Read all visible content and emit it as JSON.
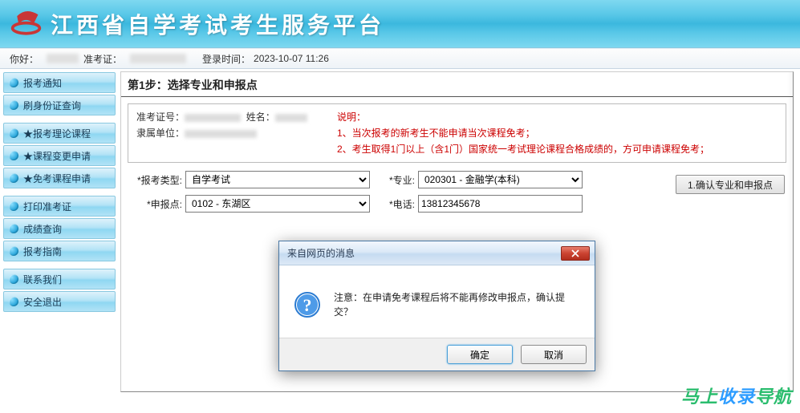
{
  "header": {
    "site_title": "江西省自学考试考生服务平台"
  },
  "topbar": {
    "greeting": "你好：",
    "id_label": "准考证：",
    "login_time_label": "登录时间：",
    "login_time_value": "2023-10-07 11:26"
  },
  "sidebar": {
    "groups": [
      {
        "items": [
          {
            "label": "报考通知",
            "name": "nav-notice"
          },
          {
            "label": "刷身份证查询",
            "name": "nav-idcard-query"
          }
        ]
      },
      {
        "items": [
          {
            "label": "★报考理论课程",
            "name": "nav-theory"
          },
          {
            "label": "★课程变更申请",
            "name": "nav-course-change"
          },
          {
            "label": "★免考课程申请",
            "name": "nav-exempt-apply",
            "active": true
          }
        ]
      },
      {
        "items": [
          {
            "label": "打印准考证",
            "name": "nav-print-ticket"
          },
          {
            "label": "成绩查询",
            "name": "nav-score-query"
          },
          {
            "label": "报考指南",
            "name": "nav-guide"
          }
        ]
      },
      {
        "items": [
          {
            "label": "联系我们",
            "name": "nav-contact"
          },
          {
            "label": "安全退出",
            "name": "nav-logout"
          }
        ]
      }
    ]
  },
  "content": {
    "step_title": "第1步：选择专业和申报点",
    "info_left": {
      "id_label": "准考证号：",
      "name_label": "姓名：",
      "unit_label": "隶属单位："
    },
    "notice_title": "说明：",
    "notice_line1": "1、当次报考的新考生不能申请当次课程免考；",
    "notice_line2": "2、考生取得1门以上（含1门）国家统一考试理论课程合格成绩的，方可申请课程免考；",
    "form": {
      "type_label": "*报考类型:",
      "type_value": "自学考试",
      "major_label": "*专业:",
      "major_value": "020301 - 金融学(本科)",
      "point_label": "*申报点:",
      "point_value": "0102 - 东湖区",
      "phone_label": "*电话:",
      "phone_value": "13812345678"
    },
    "confirm_button": "1.确认专业和申报点"
  },
  "modal": {
    "title": "来自网页的消息",
    "message": "注意：在申请免考课程后将不能再修改申报点，确认提交？",
    "ok": "确定",
    "cancel": "取消"
  },
  "watermark": {
    "a": "马上",
    "b": "收录",
    "c": "导航"
  }
}
